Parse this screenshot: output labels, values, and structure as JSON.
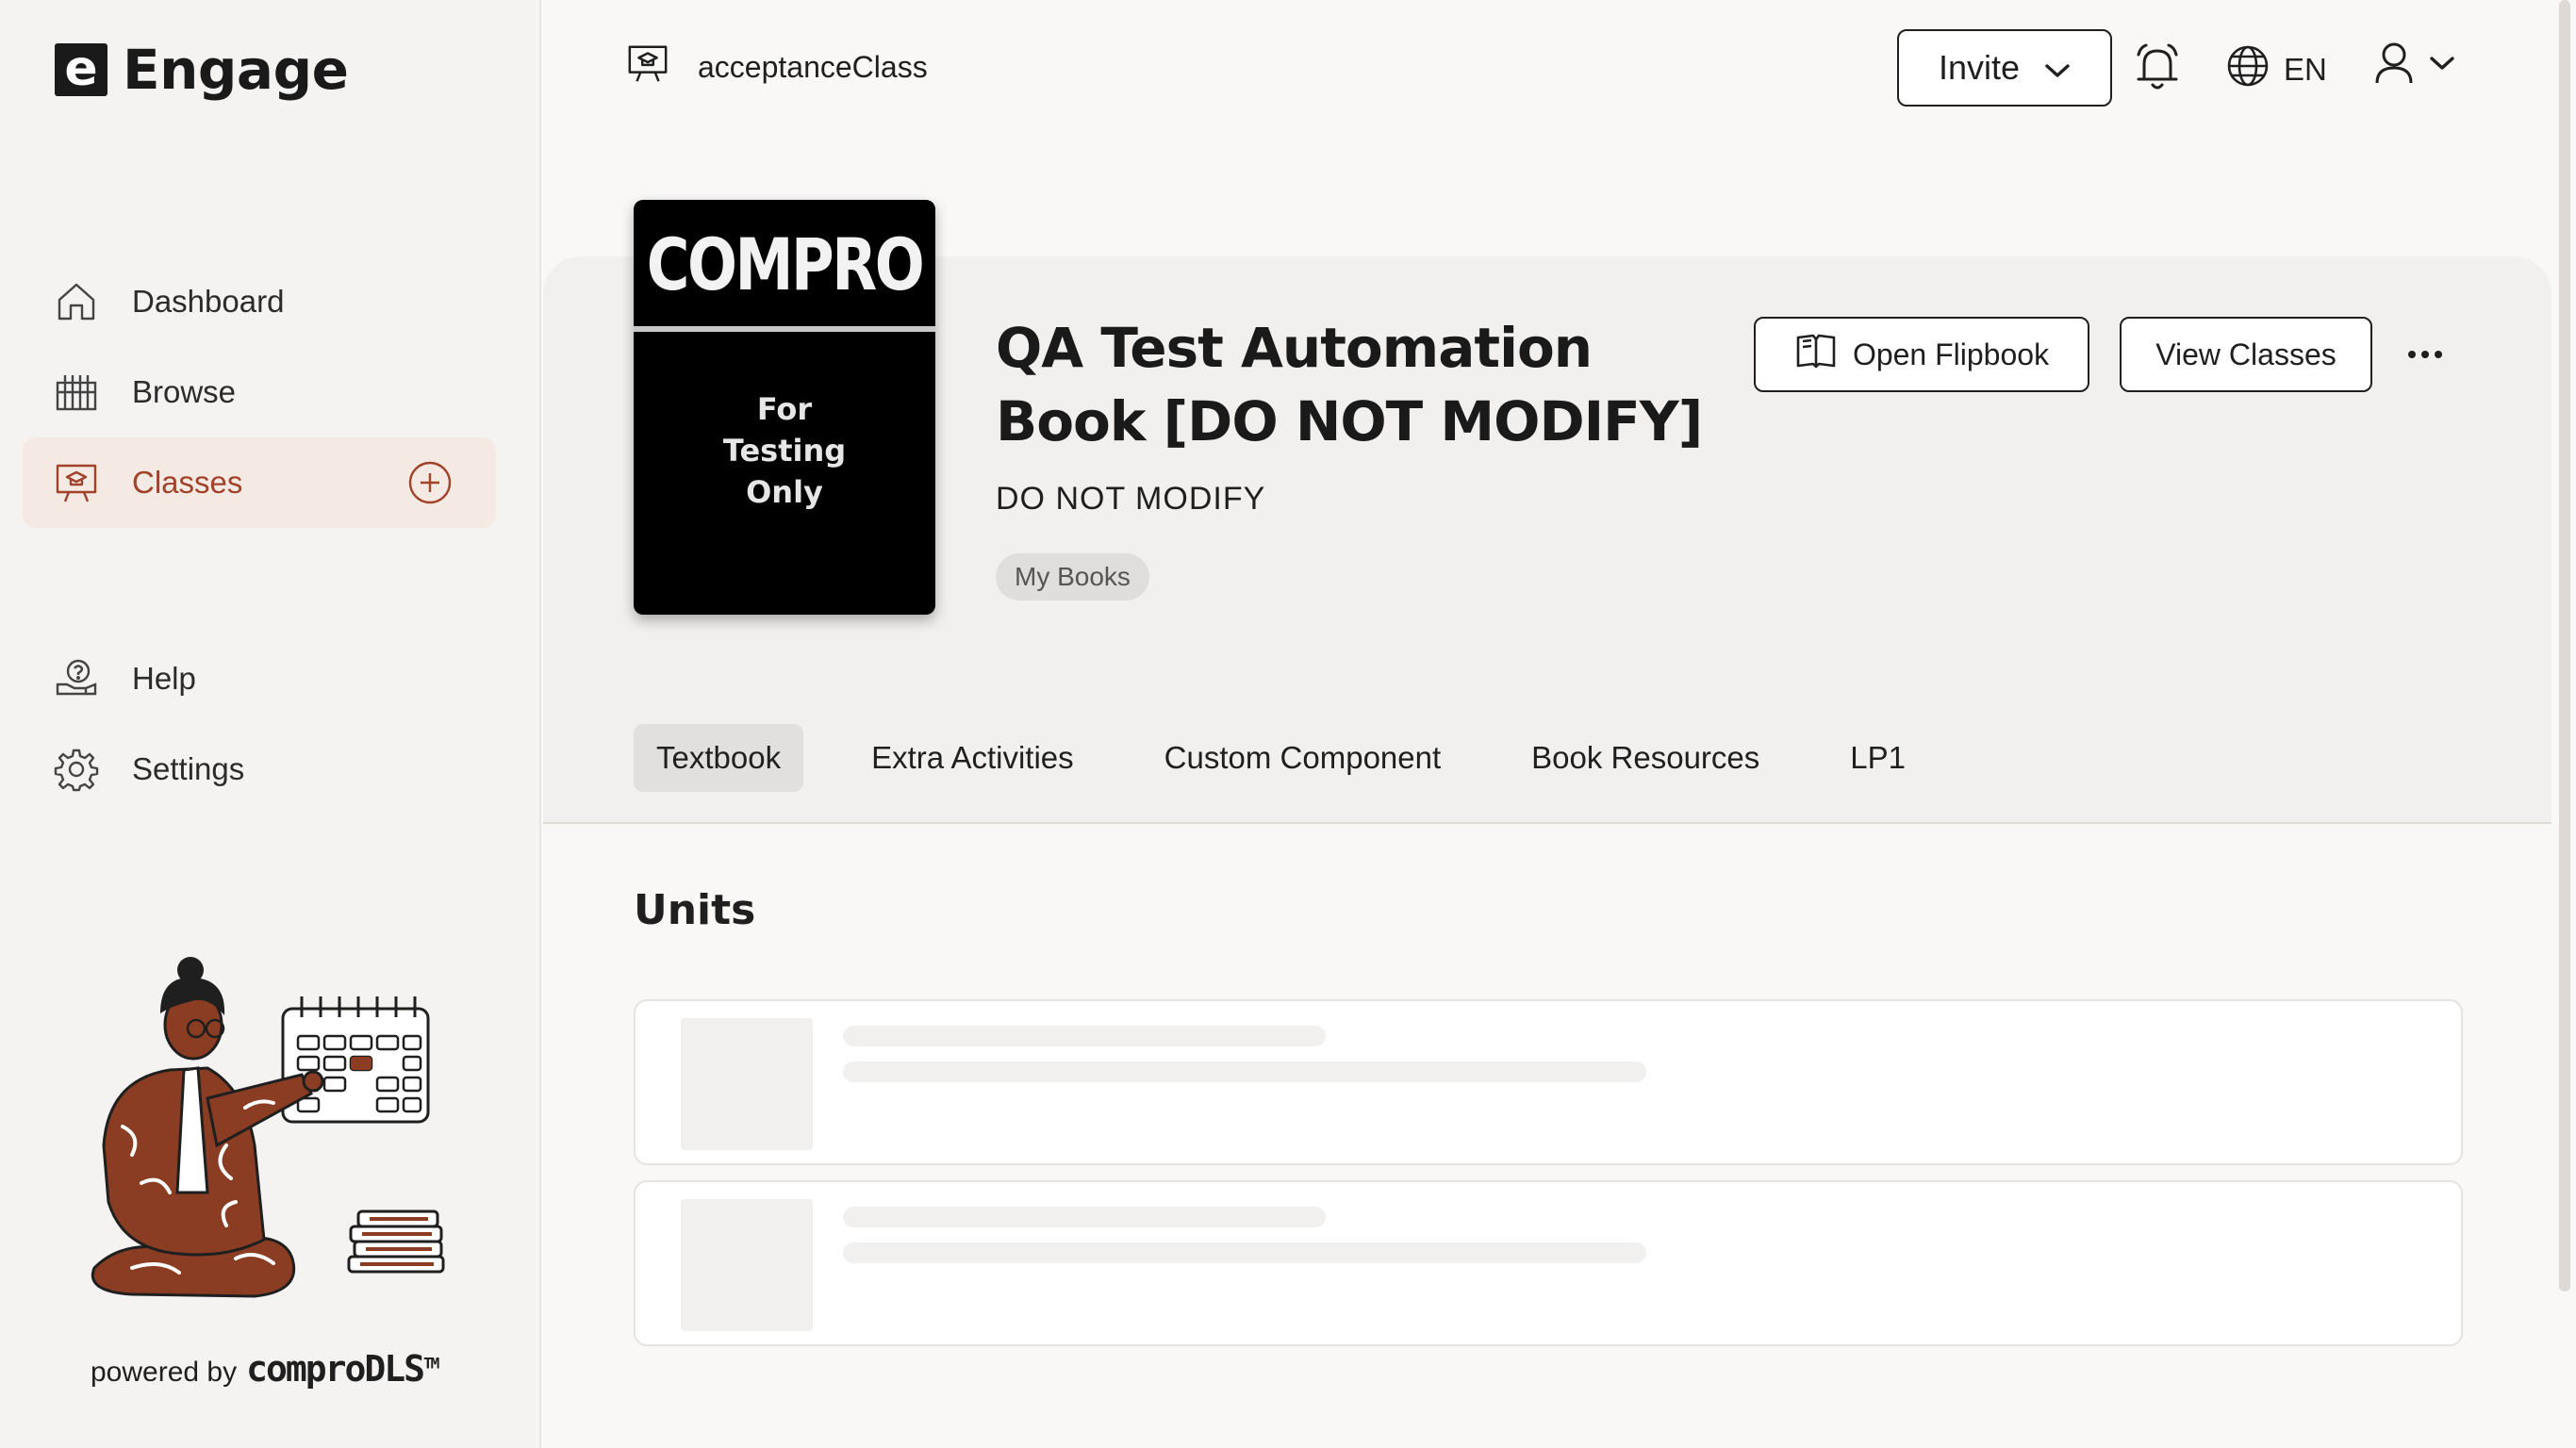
{
  "app": {
    "logo_letter": "e",
    "name": "Engage"
  },
  "sidebar": {
    "items": [
      {
        "label": "Dashboard",
        "icon": "home-icon"
      },
      {
        "label": "Browse",
        "icon": "books-icon"
      },
      {
        "label": "Classes",
        "icon": "classroom-icon",
        "active": true
      },
      {
        "label": "Help",
        "icon": "help-icon"
      },
      {
        "label": "Settings",
        "icon": "gear-icon"
      }
    ],
    "powered_prefix": "powered by",
    "powered_brand": "comproDLS",
    "powered_tm": "TM"
  },
  "header": {
    "class_name": "acceptanceClass",
    "invite_label": "Invite",
    "language": "EN"
  },
  "book": {
    "cover_title": "COMPRO",
    "cover_lines": [
      "For",
      "Testing",
      "Only"
    ],
    "title": "QA Test Automation Book [DO NOT MODIFY]",
    "subtitle": "DO NOT MODIFY",
    "tag": "My Books",
    "open_flipbook_label": "Open Flipbook",
    "view_classes_label": "View Classes"
  },
  "tabs": [
    {
      "label": "Textbook",
      "active": true
    },
    {
      "label": "Extra Activities"
    },
    {
      "label": "Custom Component"
    },
    {
      "label": "Book Resources"
    },
    {
      "label": "LP1"
    }
  ],
  "units": {
    "heading": "Units",
    "loading_cards": 2
  },
  "colors": {
    "accent": "#a0432a",
    "active_bg": "#f5e9e3",
    "panel_bg": "#f1f0ef"
  }
}
